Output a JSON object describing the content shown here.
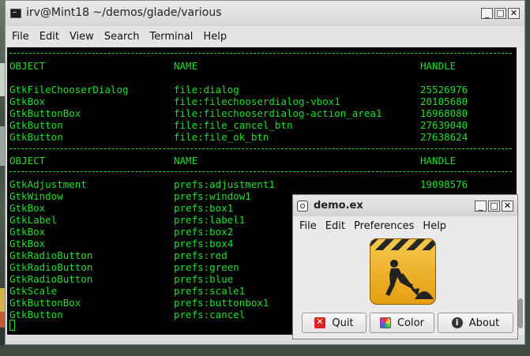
{
  "terminal": {
    "title": "irv@Mint18 ~/demos/glade/various",
    "menu": [
      "File",
      "Edit",
      "View",
      "Search",
      "Terminal",
      "Help"
    ],
    "separator": "------------------------------------------------------------------------------------------",
    "table1": {
      "headers": [
        "OBJECT",
        "NAME",
        "HANDLE"
      ],
      "rows": [
        [
          "GtkFileChooserDialog",
          "file:dialog",
          "25526976"
        ],
        [
          "GtkBox",
          "file:filechooserdialog-vbox1",
          "20105680"
        ],
        [
          "GtkButtonBox",
          "file:filechooserdialog-action_area1",
          "16968080"
        ],
        [
          "GtkButton",
          "file:file_cancel_btn",
          "27639040"
        ],
        [
          "GtkButton",
          "file:file_ok_btn",
          "27638624"
        ]
      ]
    },
    "table2": {
      "headers": [
        "OBJECT",
        "NAME",
        "HANDLE"
      ],
      "rows": [
        [
          "GtkAdjustment",
          "prefs:adjustment1",
          "19098576"
        ],
        [
          "GtkWindow",
          "prefs:window1",
          ""
        ],
        [
          "GtkBox",
          "prefs:box1",
          ""
        ],
        [
          "GtkLabel",
          "prefs:label1",
          ""
        ],
        [
          "GtkBox",
          "prefs:box2",
          ""
        ],
        [
          "GtkBox",
          "prefs:box4",
          ""
        ],
        [
          "GtkRadioButton",
          "prefs:red",
          ""
        ],
        [
          "GtkRadioButton",
          "prefs:green",
          ""
        ],
        [
          "GtkRadioButton",
          "prefs:blue",
          ""
        ],
        [
          "GtkScale",
          "prefs:scale1",
          ""
        ],
        [
          "GtkButtonBox",
          "prefs:buttonbox1",
          ""
        ],
        [
          "GtkButton",
          "prefs:cancel",
          ""
        ]
      ]
    }
  },
  "demo": {
    "title": "demo.ex",
    "menu": [
      "File",
      "Edit",
      "Preferences",
      "Help"
    ],
    "buttons": {
      "quit": "Quit",
      "color": "Color",
      "about": "About"
    }
  },
  "window_buttons": {
    "minimize": "_",
    "maximize": "□",
    "close": "✕"
  },
  "colors": {
    "terminal_fg": "#1ee02c",
    "terminal_bg": "#000000",
    "sign": "#f2b730"
  }
}
